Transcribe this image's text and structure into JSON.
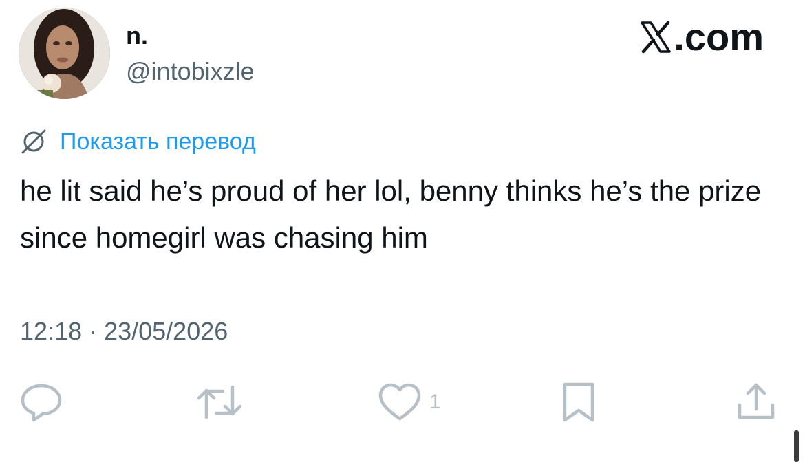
{
  "author": {
    "display_name": "n.",
    "handle": "@intobixzle",
    "avatar": "profile-photo"
  },
  "brand": {
    "logo_text": ".com",
    "logo_icon": "x-logo-icon"
  },
  "translate": {
    "label": "Показать перевод",
    "icon": "globe-icon"
  },
  "tweet": {
    "text": "he lit said he’s proud of her lol, benny thinks he’s the prize since homegirl was chasing him",
    "timestamp": "12:18 · 23/05/2026"
  },
  "actions": {
    "reply": {
      "icon": "reply-icon"
    },
    "retweet": {
      "icon": "retweet-icon"
    },
    "like": {
      "icon": "heart-icon",
      "count": "1"
    },
    "bookmark": {
      "icon": "bookmark-icon"
    },
    "share": {
      "icon": "share-icon"
    }
  },
  "colors": {
    "text": "#0f1419",
    "secondary": "#536471",
    "link": "#1d9bf0",
    "action_icons": "#b7c0c7"
  }
}
